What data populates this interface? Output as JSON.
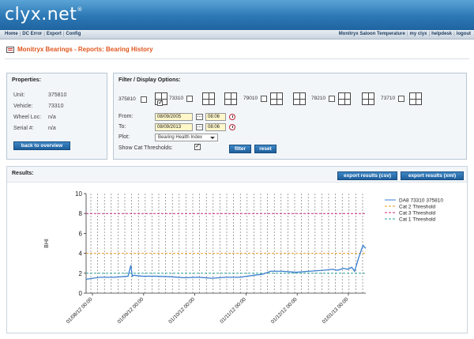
{
  "brand": {
    "name": "clyx.net",
    "mark": "®"
  },
  "nav": {
    "left": [
      "Home",
      "DC Error",
      "Export",
      "Config"
    ],
    "right": [
      "Monitryx Saloon Temperature",
      "my clyx",
      "helpdesk",
      "logout"
    ]
  },
  "page_title": "Monitryx Bearings - Reports: Bearing History",
  "properties": {
    "title": "Properties:",
    "rows": [
      {
        "key": "Unit:",
        "value": "375810"
      },
      {
        "key": "Vehicle:",
        "value": "73310"
      },
      {
        "key": "Wheel Loc:",
        "value": "n/a"
      },
      {
        "key": "Serial #:",
        "value": "n/a"
      }
    ],
    "back_button": "back to overview"
  },
  "filters": {
    "title": "Filter / Display Options:",
    "unit_label": "375810",
    "vehicles": [
      "73310",
      "79010",
      "78210",
      "73710"
    ],
    "from_label": "From:",
    "from_date": "08/09/2005",
    "from_time": "08:06",
    "to_label": "To:",
    "to_date": "08/09/2013",
    "to_time": "08:06",
    "plot_label": "Plot:",
    "plot_value": "Bearing Health Index",
    "thresholds_label": "Show Cat Thresholds:",
    "filter_button": "filter",
    "reset_button": "reset"
  },
  "results": {
    "title": "Results:",
    "export_csv": "export results (csv)",
    "export_xml": "export results (xml)"
  },
  "chart_data": {
    "type": "line",
    "ylabel": "BHI",
    "ylim": [
      0,
      10
    ],
    "yticks": [
      0,
      2,
      4,
      6,
      8,
      10
    ],
    "xticks": [
      "01/08/12 00:00",
      "01/09/12 00:00",
      "01/10/12 00:00",
      "01/11/12 00:00",
      "01/12/12 00:00",
      "01/01/13 00:00"
    ],
    "grid": "vertical dashed",
    "legend_position": "top-right",
    "series": [
      {
        "name": "DA8 73310 375810",
        "color": "#3a7fd0",
        "x": [
          0,
          0.05,
          0.1,
          0.15,
          0.16,
          0.165,
          0.17,
          0.2,
          0.25,
          0.3,
          0.35,
          0.4,
          0.45,
          0.5,
          0.55,
          0.6,
          0.63,
          0.66,
          0.7,
          0.75,
          0.8,
          0.85,
          0.88,
          0.9,
          0.92,
          0.935,
          0.95,
          0.96,
          0.975,
          0.99,
          1.0
        ],
        "y": [
          1.4,
          1.6,
          1.6,
          1.7,
          2.8,
          1.7,
          1.8,
          1.7,
          1.7,
          1.65,
          1.55,
          1.6,
          1.5,
          1.6,
          1.6,
          1.8,
          1.9,
          2.2,
          2.2,
          2.1,
          2.2,
          2.3,
          2.4,
          2.3,
          2.5,
          2.4,
          2.6,
          2.2,
          3.6,
          4.8,
          4.5
        ]
      },
      {
        "name": "Cat 2 Threshold",
        "color": "#e69a1e",
        "constant": 4
      },
      {
        "name": "Cat 3 Threshold",
        "color": "#c4287a",
        "constant": 8
      },
      {
        "name": "Cat 1 Threshold",
        "color": "#2aa39a",
        "constant": 2
      }
    ]
  }
}
